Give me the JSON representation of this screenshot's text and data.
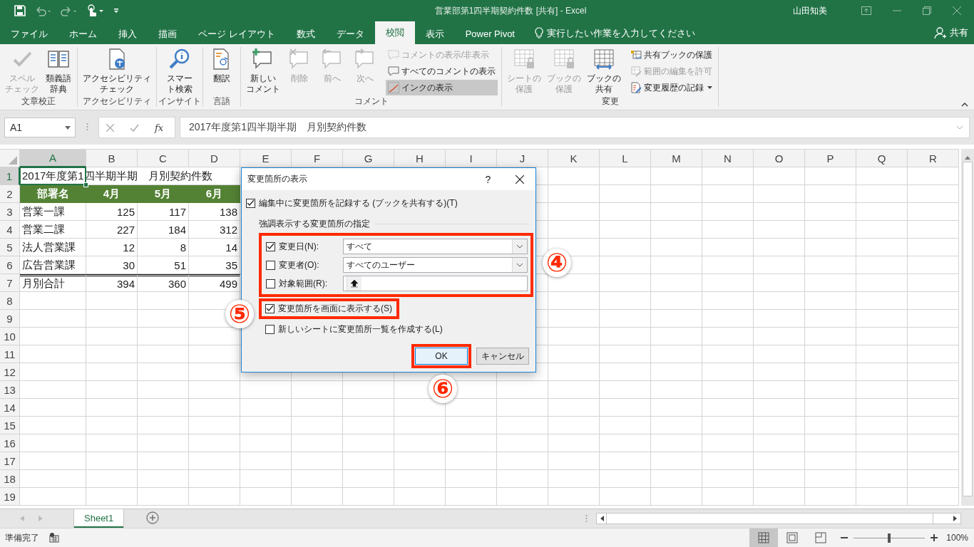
{
  "window": {
    "title": "営業部第1四半期契約件数 [共有] - Excel",
    "user": "山田知美"
  },
  "ribbon_tabs": [
    {
      "label": "ファイル",
      "selected": false
    },
    {
      "label": "ホーム",
      "selected": false
    },
    {
      "label": "挿入",
      "selected": false
    },
    {
      "label": "描画",
      "selected": false
    },
    {
      "label": "ページ レイアウト",
      "selected": false
    },
    {
      "label": "数式",
      "selected": false
    },
    {
      "label": "データ",
      "selected": false
    },
    {
      "label": "校閲",
      "selected": true
    },
    {
      "label": "表示",
      "selected": false
    },
    {
      "label": "Power Pivot",
      "selected": false
    }
  ],
  "tell_me": {
    "placeholder": "実行したい作業を入力してください"
  },
  "share": {
    "label": "共有"
  },
  "ribbon_groups": [
    {
      "label": "文章校正",
      "items": [
        {
          "kind": "large",
          "label_lines": [
            "スペル",
            "チェック"
          ],
          "disabled": true
        },
        {
          "kind": "large",
          "label_lines": [
            "類義語",
            "辞典"
          ],
          "disabled": false
        }
      ]
    },
    {
      "label": "アクセシビリティ",
      "items": [
        {
          "kind": "large",
          "label_lines": [
            "アクセシビリティ",
            "チェック"
          ],
          "disabled": false
        }
      ]
    },
    {
      "label": "インサイト",
      "items": [
        {
          "kind": "large",
          "label_lines": [
            "スマー",
            "ト検索"
          ],
          "disabled": false
        }
      ]
    },
    {
      "label": "言語",
      "items": [
        {
          "kind": "large",
          "label_lines": [
            "翻訳"
          ],
          "disabled": false
        }
      ]
    },
    {
      "label": "コメント",
      "items": [
        {
          "kind": "large",
          "label_lines": [
            "新しい",
            "コメント"
          ],
          "disabled": false
        },
        {
          "kind": "large",
          "label_lines": [
            "削除"
          ],
          "disabled": true
        },
        {
          "kind": "large",
          "label_lines": [
            "前へ"
          ],
          "disabled": true
        },
        {
          "kind": "large",
          "label_lines": [
            "次へ"
          ],
          "disabled": true
        },
        {
          "kind": "small",
          "label": "コメントの表示/非表示",
          "disabled": true,
          "selected": false,
          "dropdown": false
        },
        {
          "kind": "small",
          "label": "すべてのコメントの表示",
          "disabled": false,
          "selected": false,
          "dropdown": false
        },
        {
          "kind": "small",
          "label": "インクの表示",
          "disabled": false,
          "selected": true,
          "dropdown": false
        }
      ]
    },
    {
      "label": "変更",
      "items": [
        {
          "kind": "large",
          "label_lines": [
            "シートの",
            "保護"
          ],
          "disabled": true
        },
        {
          "kind": "large",
          "label_lines": [
            "ブックの",
            "保護"
          ],
          "disabled": true
        },
        {
          "kind": "large",
          "label_lines": [
            "ブックの",
            "共有"
          ],
          "disabled": false
        },
        {
          "kind": "small",
          "label": "共有ブックの保護",
          "disabled": false,
          "selected": false,
          "dropdown": false
        },
        {
          "kind": "small",
          "label": "範囲の編集を許可",
          "disabled": true,
          "selected": false,
          "dropdown": false
        },
        {
          "kind": "small",
          "label": "変更履歴の記録",
          "disabled": false,
          "selected": false,
          "dropdown": true
        }
      ]
    }
  ],
  "formula_bar": {
    "name_box": "A1",
    "function_label": "fx",
    "value": "2017年度第1四半期半期　月別契約件数"
  },
  "sheet": {
    "columns": [
      {
        "label": "A",
        "selected": true
      },
      {
        "label": "B",
        "selected": false
      },
      {
        "label": "C",
        "selected": false
      },
      {
        "label": "D",
        "selected": false
      },
      {
        "label": "E",
        "selected": false
      },
      {
        "label": "F",
        "selected": false
      },
      {
        "label": "G",
        "selected": false
      },
      {
        "label": "H",
        "selected": false
      },
      {
        "label": "I",
        "selected": false
      },
      {
        "label": "J",
        "selected": false
      },
      {
        "label": "K",
        "selected": false
      },
      {
        "label": "L",
        "selected": false
      },
      {
        "label": "M",
        "selected": false
      },
      {
        "label": "N",
        "selected": false
      },
      {
        "label": "O",
        "selected": false
      },
      {
        "label": "P",
        "selected": false
      },
      {
        "label": "Q",
        "selected": false
      },
      {
        "label": "R",
        "selected": false
      }
    ],
    "rows": [
      {
        "label": "1",
        "selected": true,
        "kind": "title",
        "cells": [
          "2017年度第1四半期半期　月別契約件数"
        ]
      },
      {
        "label": "2",
        "selected": false,
        "kind": "header",
        "cells": [
          "部署名",
          "4月",
          "5月",
          "6月"
        ]
      },
      {
        "label": "3",
        "selected": false,
        "kind": "data",
        "cells": [
          "営業一課",
          "125",
          "117",
          "138"
        ]
      },
      {
        "label": "4",
        "selected": false,
        "kind": "data",
        "cells": [
          "営業二課",
          "227",
          "184",
          "312"
        ]
      },
      {
        "label": "5",
        "selected": false,
        "kind": "data",
        "cells": [
          "法人営業課",
          "12",
          "8",
          "14"
        ]
      },
      {
        "label": "6",
        "selected": false,
        "kind": "data",
        "cells": [
          "広告営業課",
          "30",
          "51",
          "35"
        ]
      },
      {
        "label": "7",
        "selected": false,
        "kind": "total",
        "cells": [
          "月別合計",
          "394",
          "360",
          "499"
        ]
      },
      {
        "label": "8",
        "selected": false,
        "kind": "empty"
      },
      {
        "label": "9",
        "selected": false,
        "kind": "empty"
      },
      {
        "label": "10",
        "selected": false,
        "kind": "empty"
      },
      {
        "label": "11",
        "selected": false,
        "kind": "empty"
      },
      {
        "label": "12",
        "selected": false,
        "kind": "empty"
      },
      {
        "label": "13",
        "selected": false,
        "kind": "empty"
      },
      {
        "label": "14",
        "selected": false,
        "kind": "empty"
      },
      {
        "label": "15",
        "selected": false,
        "kind": "empty"
      },
      {
        "label": "16",
        "selected": false,
        "kind": "empty"
      },
      {
        "label": "17",
        "selected": false,
        "kind": "empty"
      },
      {
        "label": "18",
        "selected": false,
        "kind": "empty"
      },
      {
        "label": "19",
        "selected": false,
        "kind": "empty"
      }
    ]
  },
  "dialog": {
    "title": "変更箇所の表示",
    "help": "?",
    "track": {
      "label": "編集中に変更箇所を記録する (ブックを共有する)(T)",
      "checked": true
    },
    "group_label": "強調表示する変更箇所の指定",
    "criteria_highlighted": true,
    "criteria": [
      {
        "kind": "combo",
        "label": "変更日(N):",
        "checked": true,
        "value": "すべて"
      },
      {
        "kind": "combo",
        "label": "変更者(O):",
        "checked": false,
        "value": "すべてのユーザー"
      },
      {
        "kind": "range",
        "label": "対象範囲(R):",
        "checked": false
      }
    ],
    "options": [
      {
        "label": "変更箇所を画面に表示する(S)",
        "checked": true,
        "highlighted": true
      },
      {
        "label": "新しいシートに変更箇所一覧を作成する(L)",
        "checked": false,
        "highlighted": false
      }
    ],
    "buttons": [
      {
        "label": "OK",
        "default": true,
        "highlighted": true
      },
      {
        "label": "キャンセル",
        "default": false,
        "highlighted": false
      }
    ]
  },
  "callouts": [
    {
      "label": "④"
    },
    {
      "label": "⑤"
    },
    {
      "label": "⑥"
    }
  ],
  "sheet_tabs": [
    {
      "label": "Sheet1",
      "selected": true
    }
  ],
  "status_bar": {
    "text": "準備完了",
    "views": [
      {
        "selected": true
      },
      {
        "selected": false
      },
      {
        "selected": false
      }
    ],
    "zoom": {
      "level": 0.5,
      "label": "100%"
    }
  }
}
